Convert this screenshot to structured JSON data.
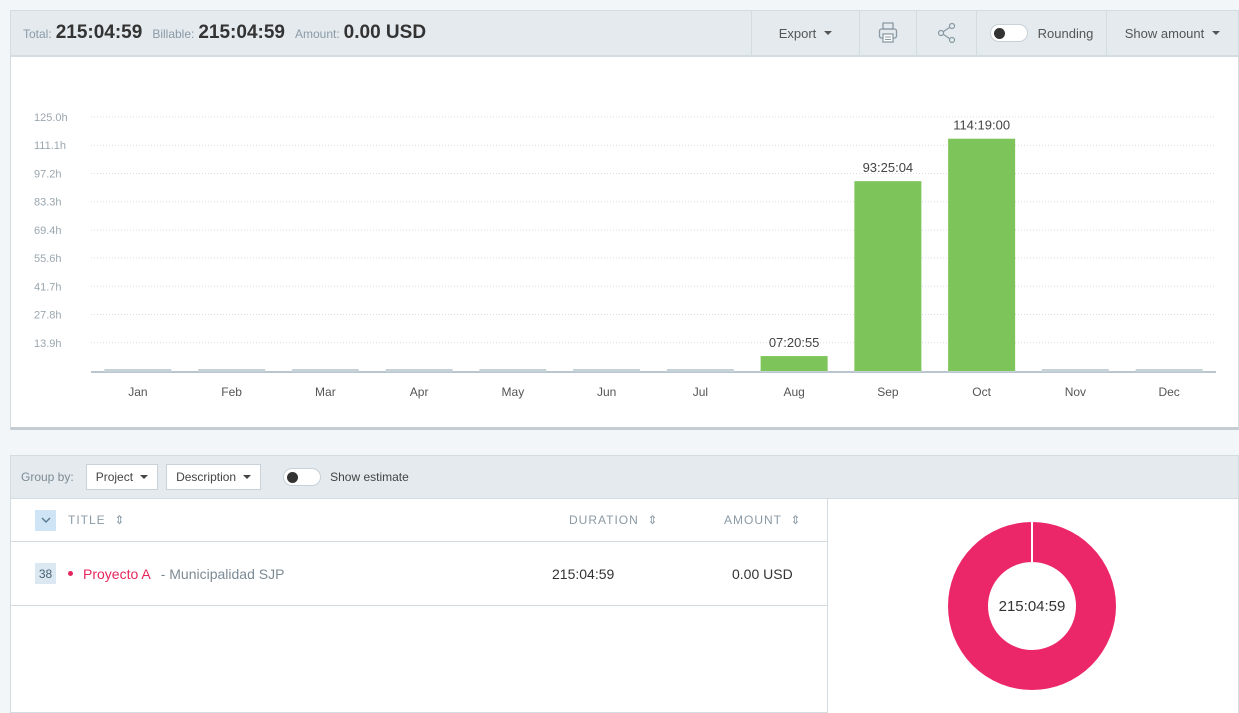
{
  "summary": {
    "total_label": "Total:",
    "total_value": "215:04:59",
    "billable_label": "Billable:",
    "billable_value": "215:04:59",
    "amount_label": "Amount:",
    "amount_value": "0.00 USD"
  },
  "toolbar": {
    "export_label": "Export",
    "print_icon": "printer-icon",
    "share_icon": "share-icon",
    "rounding_label": "Rounding",
    "show_amount_label": "Show amount"
  },
  "chart_data": {
    "type": "bar",
    "categories": [
      "Jan",
      "Feb",
      "Mar",
      "Apr",
      "May",
      "Jun",
      "Jul",
      "Aug",
      "Sep",
      "Oct",
      "Nov",
      "Dec"
    ],
    "values": [
      0,
      0,
      0,
      0,
      0,
      0,
      0,
      7.35,
      93.42,
      114.32,
      0,
      0
    ],
    "data_labels": [
      "",
      "",
      "",
      "",
      "",
      "",
      "",
      "07:20:55",
      "93:25:04",
      "114:19:00",
      "",
      ""
    ],
    "y_ticks": [
      "125.0h",
      "111.1h",
      "97.2h",
      "83.3h",
      "69.4h",
      "55.6h",
      "41.7h",
      "27.8h",
      "13.9h"
    ],
    "ylim": [
      0,
      125
    ],
    "grid": true,
    "bar_color": "#7dc45a"
  },
  "grouping": {
    "label": "Group by:",
    "group1": "Project",
    "group2": "Description",
    "show_estimate_label": "Show estimate"
  },
  "table": {
    "columns": {
      "title": "TITLE",
      "duration": "DURATION",
      "amount": "AMOUNT"
    },
    "rows": [
      {
        "count": "38",
        "project": "Proyecto A",
        "client": "- Municipalidad SJP",
        "duration": "215:04:59",
        "amount": "0.00 USD",
        "color": "#e5265c"
      }
    ]
  },
  "donut": {
    "center_label": "215:04:59",
    "color": "#ec2769"
  }
}
